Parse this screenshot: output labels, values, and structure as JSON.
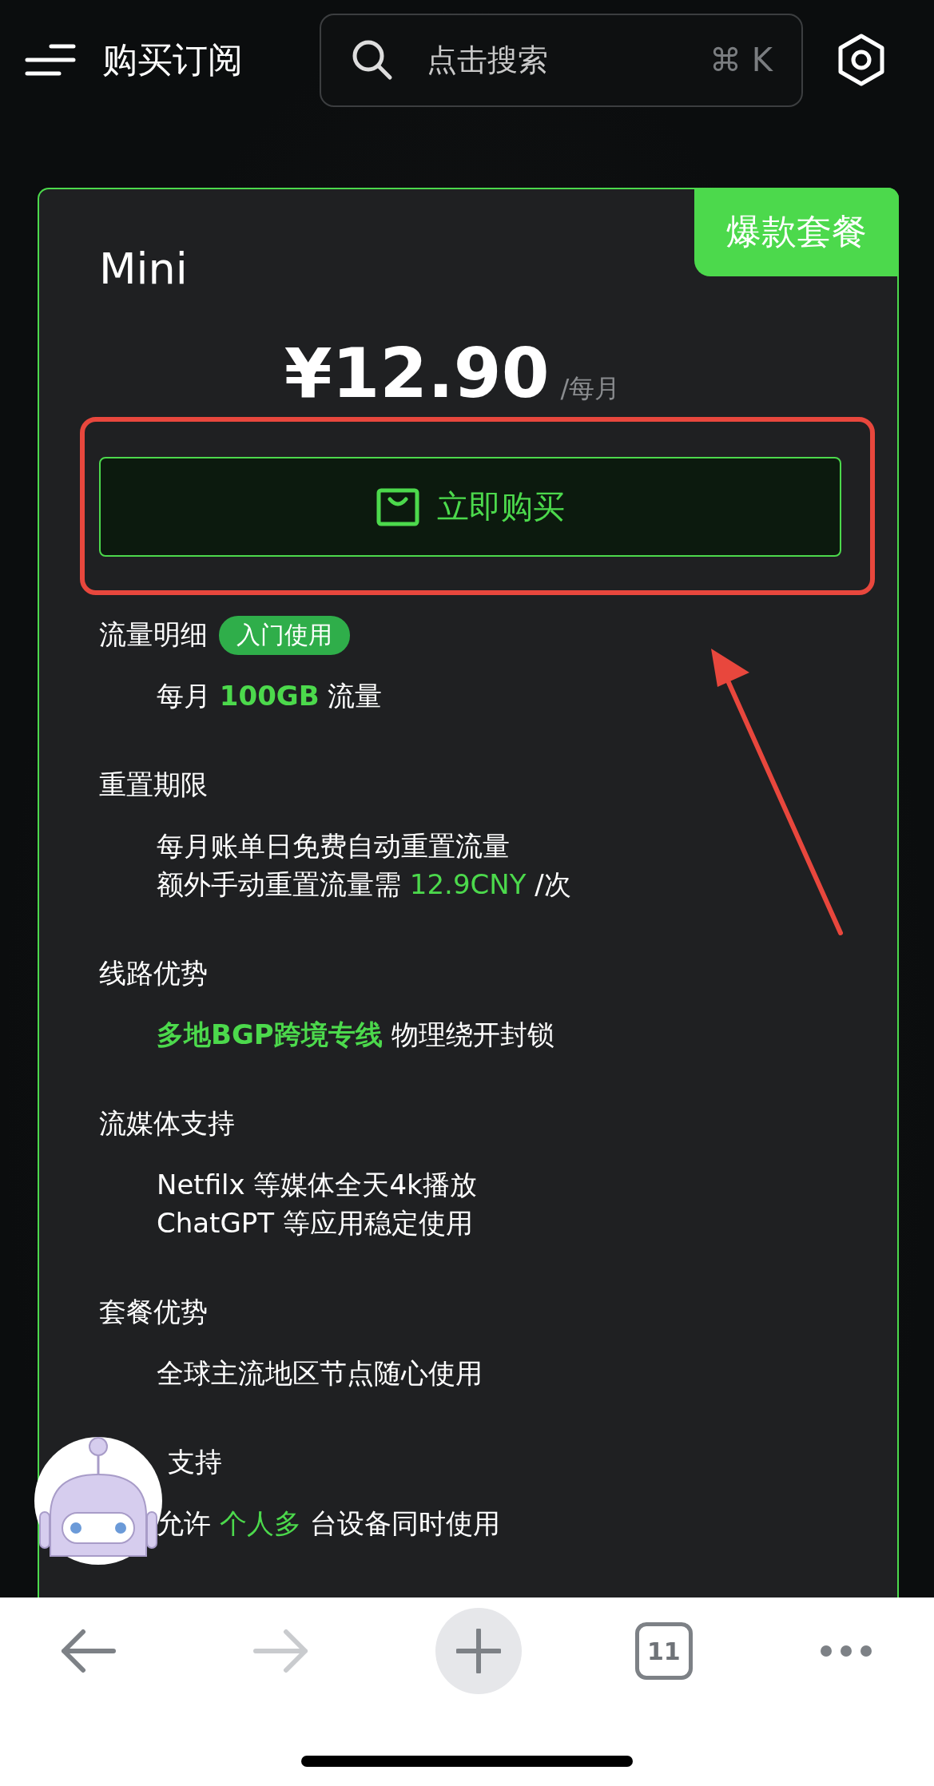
{
  "header": {
    "title": "购买订阅",
    "search": {
      "placeholder": "点击搜索",
      "shortcut": "⌘ K"
    }
  },
  "plan": {
    "name": "Mini",
    "badge": "爆款套餐",
    "price": "¥12.90",
    "period": "/每月",
    "buy_label": "立即购买",
    "sections": [
      {
        "title": "流量明细",
        "tag": "入门使用",
        "lines": [
          [
            {
              "text": "每月 ",
              "accent": false,
              "bold": false
            },
            {
              "text": "100GB",
              "accent": true,
              "bold": true
            },
            {
              "text": " 流量",
              "accent": false,
              "bold": false
            }
          ]
        ]
      },
      {
        "title": "重置期限",
        "lines": [
          [
            {
              "text": "每月账单日免费自动重置流量",
              "accent": false,
              "bold": false
            }
          ],
          [
            {
              "text": "额外手动重置流量需 ",
              "accent": false,
              "bold": false
            },
            {
              "text": "12.9CNY",
              "accent": true,
              "bold": false
            },
            {
              "text": " /次",
              "accent": false,
              "bold": false
            }
          ]
        ]
      },
      {
        "title": "线路优势",
        "lines": [
          [
            {
              "text": "多地BGP跨境专线",
              "accent": true,
              "bold": true
            },
            {
              "text": " 物理绕开封锁",
              "accent": false,
              "bold": false
            }
          ]
        ]
      },
      {
        "title": "流媒体支持",
        "lines": [
          [
            {
              "text": "Netfilx 等媒体全天4k播放",
              "accent": false,
              "bold": false
            }
          ],
          [
            {
              "text": "ChatGPT 等应用稳定使用",
              "accent": false,
              "bold": false
            }
          ]
        ]
      },
      {
        "title": "套餐优势",
        "lines": [
          [
            {
              "text": "全球主流地区节点随心使用",
              "accent": false,
              "bold": false
            }
          ]
        ]
      },
      {
        "title": "支持",
        "lead_hidden": true,
        "lines": [
          [
            {
              "text": "允许 ",
              "accent": false,
              "bold": false
            },
            {
              "text": "个人多",
              "accent": true,
              "bold": false
            },
            {
              "text": " 台设备同时使用",
              "accent": false,
              "bold": false
            }
          ]
        ]
      }
    ]
  },
  "toolbar": [
    {
      "kind": "back",
      "disabled": false
    },
    {
      "kind": "forward",
      "disabled": true
    },
    {
      "kind": "new-tab",
      "disabled": false
    },
    {
      "kind": "tabs",
      "count": "11",
      "disabled": false
    },
    {
      "kind": "more",
      "disabled": false
    }
  ]
}
